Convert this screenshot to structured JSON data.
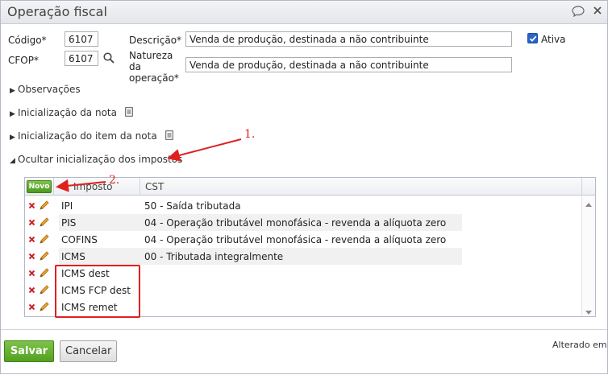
{
  "window": {
    "title": "Operação fiscal"
  },
  "form": {
    "codigo_label": "Código*",
    "codigo_value": "6107",
    "cfop_label": "CFOP*",
    "cfop_value": "6107",
    "descricao_label": "Descrição*",
    "descricao_value": "Venda de produção, destinada a não contribuinte",
    "natureza_label_1": "Natureza",
    "natureza_label_2": "da",
    "natureza_label_3": "operação*",
    "natureza_value": "Venda de produção, destinada a não contribuinte",
    "ativa_label": "Ativa",
    "ativa_checked": true
  },
  "sections": {
    "observacoes": "Observações",
    "inicializacao_nota": "Inicialização da nota",
    "inicializacao_item": "Inicialização do item da nota",
    "ocultar_impostos": "Ocultar inicialização dos impostos"
  },
  "grid": {
    "novo_label": "Novo",
    "col_imposto": "Imposto",
    "col_cst": "CST",
    "rows": [
      {
        "imposto": "IPI",
        "cst": "50 - Saída tributada"
      },
      {
        "imposto": "PIS",
        "cst": "04 - Operação tributável monofásica - revenda a alíquota zero"
      },
      {
        "imposto": "COFINS",
        "cst": "04 - Operação tributável monofásica - revenda a alíquota zero"
      },
      {
        "imposto": "ICMS",
        "cst": "00 - Tributada integralmente"
      },
      {
        "imposto": "ICMS dest",
        "cst": ""
      },
      {
        "imposto": "ICMS FCP dest",
        "cst": ""
      },
      {
        "imposto": "ICMS remet",
        "cst": ""
      }
    ]
  },
  "footer": {
    "salvar_label": "Salvar",
    "cancelar_label": "Cancelar",
    "alterado_label": "Alterado em"
  },
  "annotations": {
    "step1": "1.",
    "step2": "2."
  },
  "colors": {
    "primary_green": "#5aa627",
    "annotation_red": "#e02020",
    "checkbox_blue": "#2a64c8"
  }
}
